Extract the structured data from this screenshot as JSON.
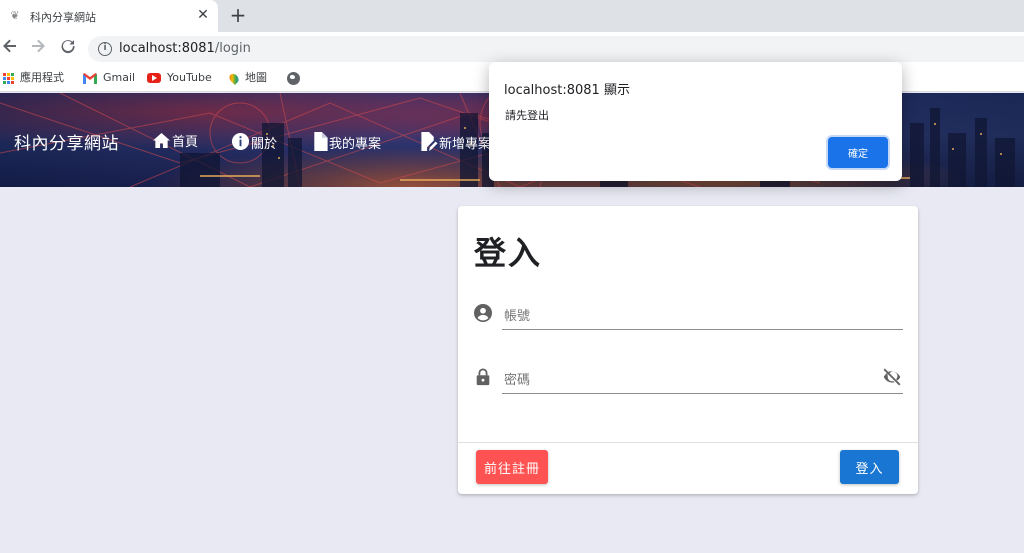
{
  "browser": {
    "tab_title": "科內分享網站",
    "tab_close": "✕",
    "new_tab": "+",
    "url_host": "localhost:8081",
    "url_path": "/login",
    "bookmarks": [
      {
        "label": "應用程式",
        "icon": "apps-grid-icon"
      },
      {
        "label": "Gmail",
        "icon": "gmail-icon"
      },
      {
        "label": "YouTube",
        "icon": "youtube-icon"
      },
      {
        "label": "地圖",
        "icon": "maps-icon"
      }
    ]
  },
  "site": {
    "brand": "科內分享網站",
    "nav": [
      {
        "label": "首頁",
        "icon": "home-icon"
      },
      {
        "label": "關於",
        "icon": "info-icon"
      },
      {
        "label": "我的專案",
        "icon": "document-icon"
      },
      {
        "label": "新增專案",
        "icon": "edit-document-icon"
      }
    ]
  },
  "login": {
    "title": "登入",
    "account_placeholder": "帳號",
    "password_placeholder": "密碼",
    "register_label": "前往註冊",
    "login_label": "登入"
  },
  "dialog": {
    "title": "localhost:8081 顯示",
    "message": "請先登出",
    "ok_label": "確定"
  },
  "colors": {
    "register_button": "#ff5252",
    "login_button": "#1976d2",
    "dialog_ok": "#1a73e8",
    "page_background": "#e8e9f3"
  }
}
